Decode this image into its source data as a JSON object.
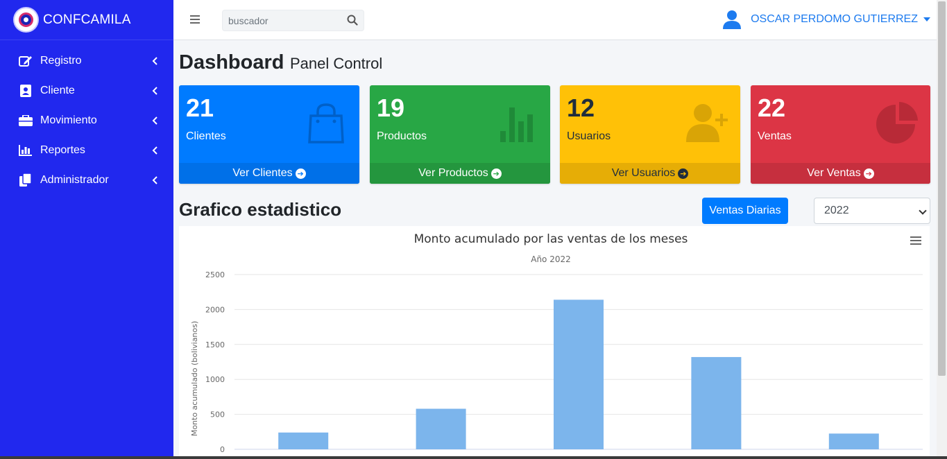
{
  "brand": {
    "name": "CONFCAMILA"
  },
  "sidebar": {
    "items": [
      {
        "label": "Registro",
        "icon": "edit-icon"
      },
      {
        "label": "Cliente",
        "icon": "id-card-icon"
      },
      {
        "label": "Movimiento",
        "icon": "briefcase-icon"
      },
      {
        "label": "Reportes",
        "icon": "bar-chart-icon"
      },
      {
        "label": "Administrador",
        "icon": "copy-icon"
      }
    ]
  },
  "topbar": {
    "search_placeholder": "buscador",
    "user_name": "OSCAR PERDOMO GUTIERREZ"
  },
  "header": {
    "title": "Dashboard",
    "subtitle": "Panel Control"
  },
  "boxes": [
    {
      "count": "21",
      "label": "Clientes",
      "link": "Ver Clientes",
      "icon": "shopping-bag-icon",
      "color": "#007bff"
    },
    {
      "count": "19",
      "label": "Productos",
      "link": "Ver Productos",
      "icon": "stats-bars-icon",
      "color": "#28a745"
    },
    {
      "count": "12",
      "label": "Usuarios",
      "link": "Ver Usuarios",
      "icon": "person-add-icon",
      "color": "#ffc107"
    },
    {
      "count": "22",
      "label": "Ventas",
      "link": "Ver Ventas",
      "icon": "pie-chart-icon",
      "color": "#dc3545"
    }
  ],
  "section": {
    "title": "Grafico estadistico",
    "button_label": "Ventas Diarias",
    "year_selected": "2022"
  },
  "chart_data": {
    "type": "bar",
    "title": "Monto acumulado por las ventas de los meses",
    "subtitle": "Año 2022",
    "xlabel": "",
    "ylabel": "Monto acumulado (bolivianos)",
    "ylim": [
      0,
      2500
    ],
    "yticks": [
      0,
      500,
      1000,
      1500,
      2000,
      2500
    ],
    "values": [
      240,
      580,
      2140,
      1320,
      225
    ],
    "bar_color": "#7cb5ec",
    "grid": true
  }
}
